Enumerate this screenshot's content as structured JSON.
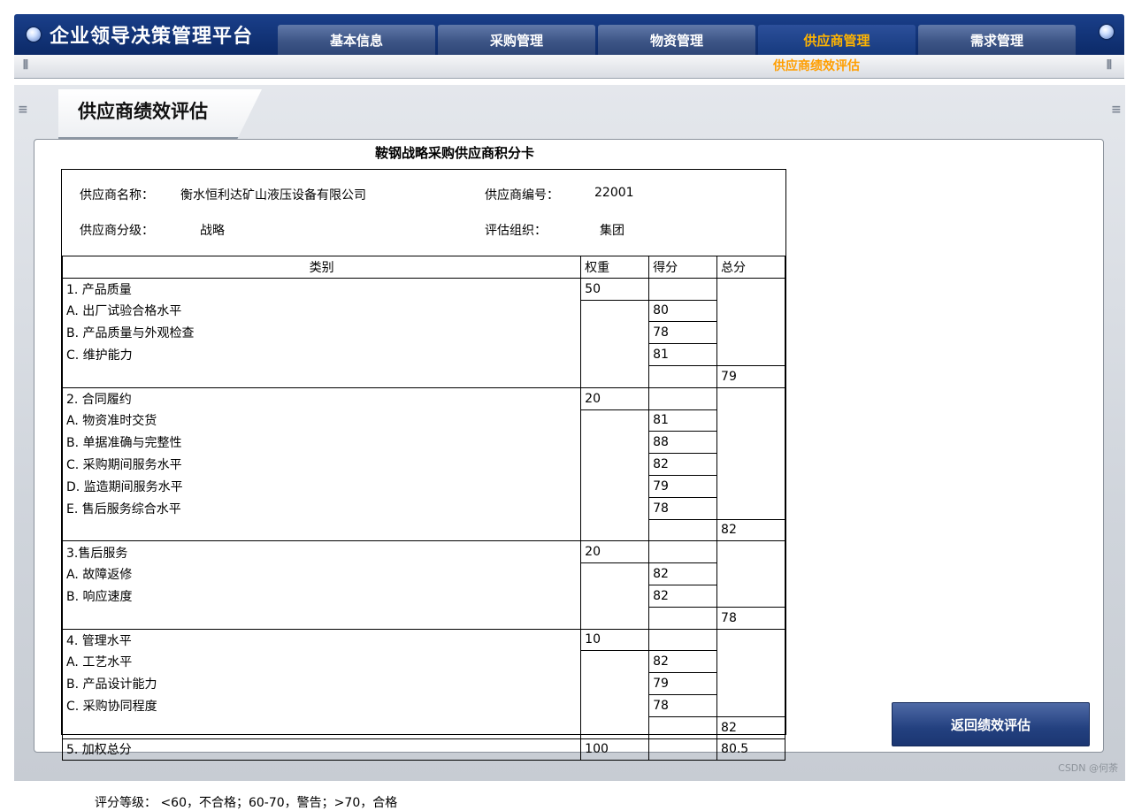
{
  "app": {
    "title": "企业领导决策管理平台",
    "nav": [
      "基本信息",
      "采购管理",
      "物资管理",
      "供应商管理",
      "需求管理"
    ],
    "active_nav": "供应商管理",
    "sub_link": "供应商绩效评估"
  },
  "page": {
    "title": "供应商绩效评估",
    "card_title": "鞍钢战略采购供应商积分卡",
    "supplier_name_label": "供应商名称：",
    "supplier_name": "衡水恒利达矿山液压设备有限公司",
    "supplier_code_label": "供应商编号：",
    "supplier_code": "22001",
    "supplier_level_label": "供应商分级：",
    "supplier_level": "战略",
    "eval_org_label": "评估组织：",
    "eval_org": "集团",
    "columns": {
      "category": "类别",
      "weight": "权重",
      "score": "得分",
      "total": "总分"
    },
    "categories": [
      {
        "name": "1. 产品质量",
        "weight": "50",
        "items": [
          {
            "name": "A. 出厂试验合格水平",
            "score": "80"
          },
          {
            "name": "B. 产品质量与外观检查",
            "score": "78"
          },
          {
            "name": "C. 维护能力",
            "score": "81"
          }
        ],
        "total": "79"
      },
      {
        "name": "2. 合同履约",
        "weight": "20",
        "items": [
          {
            "name": "A. 物资准时交货",
            "score": "81"
          },
          {
            "name": "B. 单据准确与完整性",
            "score": "88"
          },
          {
            "name": "C. 采购期间服务水平",
            "score": "82"
          },
          {
            "name": "D. 监造期间服务水平",
            "score": "79"
          },
          {
            "name": "E. 售后服务综合水平",
            "score": "78"
          }
        ],
        "total": "82"
      },
      {
        "name": "3.售后服务",
        "weight": "20",
        "items": [
          {
            "name": "A. 故障返修",
            "score": "82"
          },
          {
            "name": "B. 响应速度",
            "score": "82"
          }
        ],
        "total": "78"
      },
      {
        "name": "4. 管理水平",
        "weight": "10",
        "items": [
          {
            "name": "A. 工艺水平",
            "score": "82"
          },
          {
            "name": "B. 产品设计能力",
            "score": "79"
          },
          {
            "name": "C. 采购协同程度",
            "score": "78"
          }
        ],
        "total": "82"
      }
    ],
    "weighted_total": {
      "name": "5. 加权总分",
      "weight": "100",
      "total": "80.5"
    },
    "grade_note": "评分等级： <60，不合格；60-70，警告；>70，合格",
    "return_button": "返回绩效评估",
    "watermark": "CSDN @何荼"
  }
}
